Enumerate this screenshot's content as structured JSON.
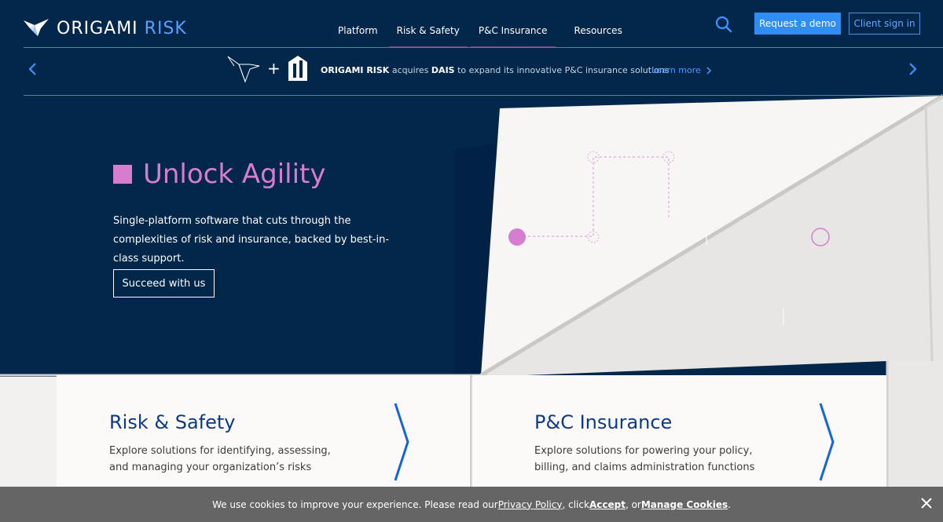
{
  "header": {
    "logo_word1": "ORIGAMI",
    "logo_word2": "RISK",
    "nav": [
      "Platform",
      "Risk & Safety",
      "P&C Insurance",
      "Resources"
    ],
    "request_demo": "Request a demo",
    "client_sign_in": "Client sign in"
  },
  "announcement": {
    "plus": "+",
    "company": "ORIGAMI RISK",
    "verb": " acquires ",
    "acquired": "DAIS",
    "rest": " to expand its innovative P&C insurance solutions",
    "learn_more": "Learn more"
  },
  "hero": {
    "title": "Unlock Agility",
    "description": "Single-platform software that cuts through the complexities of risk and insurance, backed by best-in-class support.",
    "cta": "Succeed with us"
  },
  "cards": [
    {
      "title": "Risk & Safety",
      "description": "Explore solutions for identifying, assessing, and managing your organization’s risks"
    },
    {
      "title": "P&C Insurance",
      "description": "Explore solutions for powering your policy, billing, and claims administration functions"
    }
  ],
  "cookie": {
    "text1": "We use cookies to improve your experience. Please read our ",
    "privacy": "Privacy Policy",
    "text2": ", click ",
    "accept": "Accept",
    "text3": ", or ",
    "manage": "Manage Cookies",
    "text4": "."
  },
  "colors": {
    "navy": "#03274b",
    "accent_blue": "#2f8ef5",
    "pink": "#d77dd0",
    "card_title": "#0b3a86",
    "cookie_bg": "#656565"
  },
  "icons": [
    "origami-bird-icon",
    "search-icon",
    "chevron-left-icon",
    "chevron-right-icon",
    "dais-logo-icon",
    "chevron-large-icon",
    "close-icon"
  ]
}
